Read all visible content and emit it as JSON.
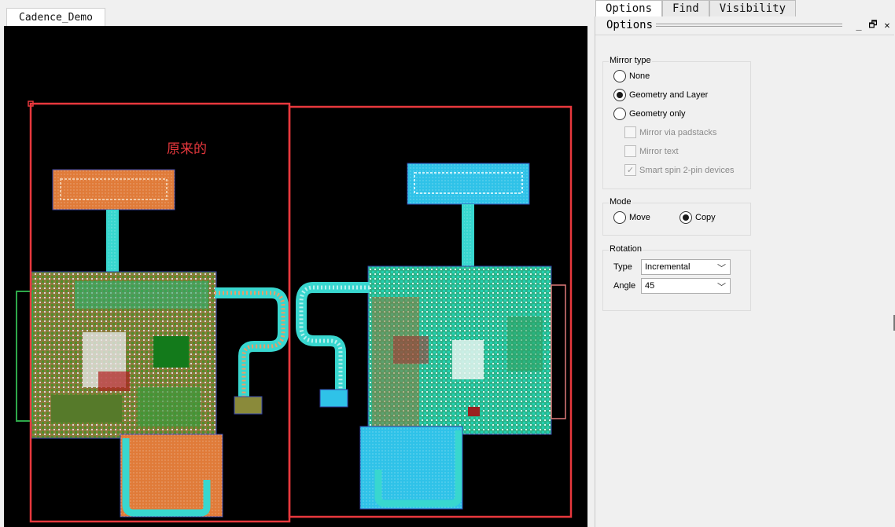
{
  "document_tab": {
    "title": "Cadence_Demo"
  },
  "canvas": {
    "annotation": "原来的",
    "colors": {
      "background": "#000000",
      "selection": "#e8383d",
      "original": "#e07b39",
      "copy": "#2fc2e8"
    }
  },
  "panel_tabs": {
    "options": "Options",
    "find": "Find",
    "visibility": "Visibility"
  },
  "panel_header": {
    "title": "Options",
    "minimize": "_",
    "restore": "🗗",
    "close": "✕"
  },
  "mirror": {
    "title": "Mirror type",
    "none": "None",
    "geometry_and_layer": "Geometry and Layer",
    "geometry_only": "Geometry only",
    "via_padstacks": "Mirror via padstacks",
    "mirror_text": "Mirror text",
    "smart_spin": "Smart spin 2-pin devices",
    "selected": "Geometry and Layer"
  },
  "mode": {
    "title": "Mode",
    "move": "Move",
    "copy": "Copy",
    "selected": "Copy"
  },
  "rotation": {
    "title": "Rotation",
    "type_label": "Type",
    "type_value": "Incremental",
    "angle_label": "Angle",
    "angle_value": "45"
  }
}
